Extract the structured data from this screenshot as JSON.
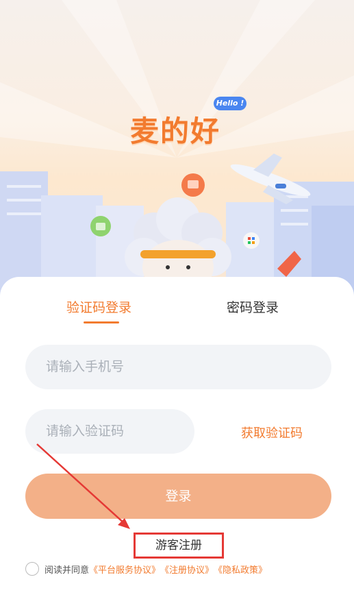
{
  "brand": {
    "logo_text": "麦的好",
    "hello_badge": "Hello !"
  },
  "tabs": [
    {
      "label": "验证码登录",
      "active": true
    },
    {
      "label": "密码登录",
      "active": false
    }
  ],
  "form": {
    "phone_placeholder": "请输入手机号",
    "code_placeholder": "请输入验证码",
    "get_code_label": "获取验证码",
    "login_label": "登录",
    "guest_register_label": "游客注册"
  },
  "agreement": {
    "checked": false,
    "prefix": "阅读并同意",
    "links": [
      "《平台服务协议》",
      "《注册协议》",
      "《隐私政策》"
    ]
  },
  "colors": {
    "accent": "#f27b2f",
    "login_button": "#f3b088",
    "highlight_box": "#e53935",
    "input_bg": "#f2f4f7"
  }
}
